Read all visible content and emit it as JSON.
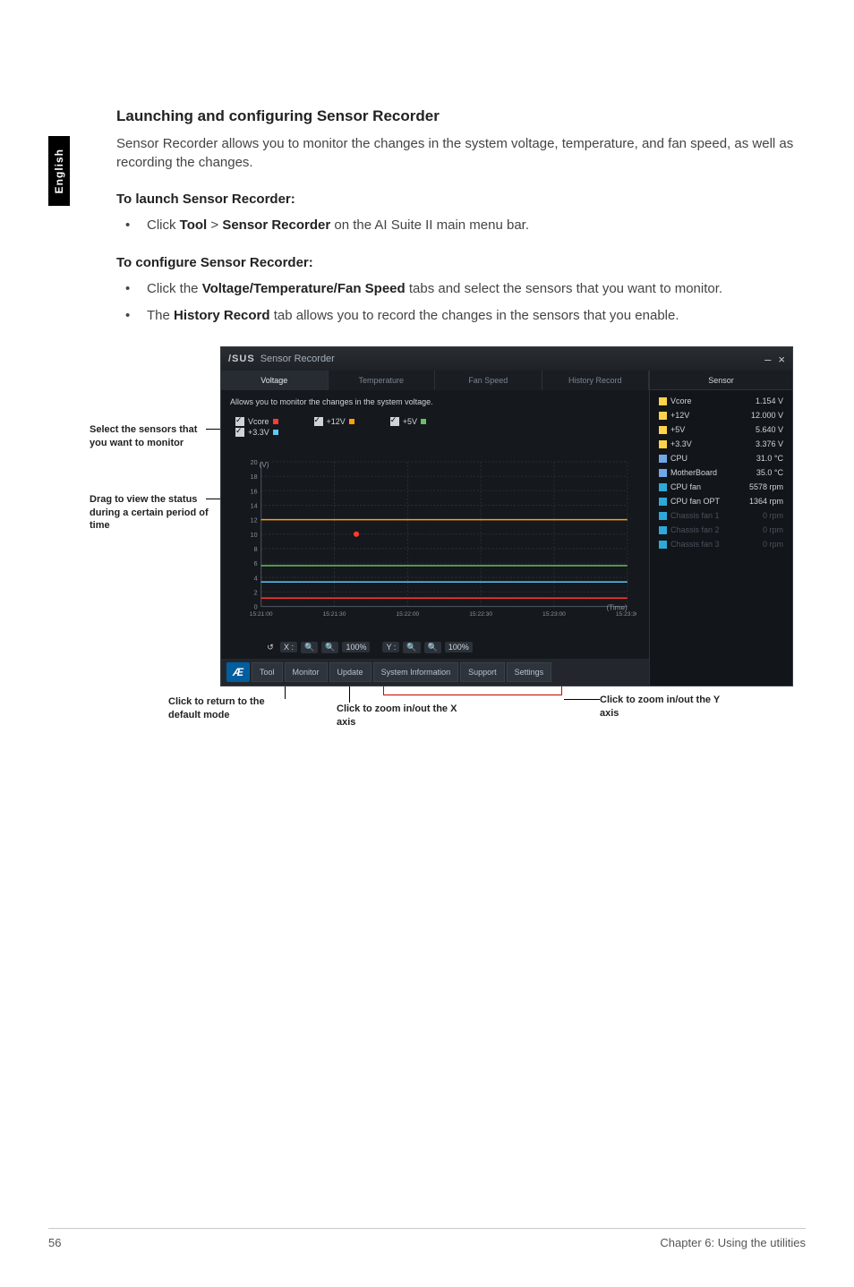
{
  "sidebar_tab": "English",
  "heading": "Launching and configuring Sensor Recorder",
  "lead": "Sensor Recorder allows you to monitor the changes in the system voltage, temperature, and fan speed, as well as recording the changes.",
  "launch_head": "To launch Sensor Recorder:",
  "launch_item_pre": "Click ",
  "launch_tool": "Tool",
  "launch_gt": " > ",
  "launch_sr": "Sensor Recorder",
  "launch_item_post": " on the AI Suite II main menu bar.",
  "config_head": "To configure Sensor Recorder:",
  "config_item1_pre": "Click the ",
  "config_item1_b": "Voltage/Temperature/Fan Speed",
  "config_item1_post": " tabs and select the sensors that you want to monitor.",
  "config_item2_pre": "The ",
  "config_item2_b": "History Record",
  "config_item2_post": " tab allows you to record the changes in the sensors that you enable.",
  "callout_select": "Select the sensors that you want to monitor",
  "callout_drag": "Drag to view the status during a certain period of time",
  "callout_return": "Click to return to the default mode",
  "callout_zoomx": "Click to zoom in/out the X axis",
  "callout_zoomy": "Click to zoom in/out the Y axis",
  "app": {
    "logo": "/SUS",
    "title": "Sensor Recorder",
    "tabs": {
      "voltage": "Voltage",
      "temperature": "Temperature",
      "fanspeed": "Fan Speed",
      "history": "History Record"
    },
    "desc": "Allows you to monitor the changes in the system voltage.",
    "checks": {
      "vcore": "Vcore",
      "p12v": "+12V",
      "p5v": "+5V",
      "p3v": "+3.3V"
    },
    "x_zoom": "X :",
    "y_zoom": "Y :",
    "zoom_pct": "100%",
    "bottombar": {
      "tool": "Tool",
      "monitor": "Monitor",
      "update": "Update",
      "sysinfo": "System Information",
      "support": "Support",
      "settings": "Settings"
    },
    "side_head": "Sensor",
    "sensors": [
      {
        "name": "Vcore",
        "val": "1.154 V",
        "color": "#ffd24a"
      },
      {
        "name": "+12V",
        "val": "12.000 V",
        "color": "#ffd24a"
      },
      {
        "name": "+5V",
        "val": "5.640 V",
        "color": "#ffd24a"
      },
      {
        "name": "+3.3V",
        "val": "3.376 V",
        "color": "#ffd24a"
      },
      {
        "name": "CPU",
        "val": "31.0 °C",
        "color": "#6fa8e6"
      },
      {
        "name": "MotherBoard",
        "val": "35.0 °C",
        "color": "#6fa8e6"
      },
      {
        "name": "CPU fan",
        "val": "5578 rpm",
        "color": "#2ea8d8"
      },
      {
        "name": "CPU fan OPT",
        "val": "1364 rpm",
        "color": "#2ea8d8"
      },
      {
        "name": "Chassis fan 1",
        "val": "0 rpm",
        "dim": true,
        "color": "#2ea8d8"
      },
      {
        "name": "Chassis fan 2",
        "val": "0 rpm",
        "dim": true,
        "color": "#2ea8d8"
      },
      {
        "name": "Chassis fan 3",
        "val": "0 rpm",
        "dim": true,
        "color": "#2ea8d8"
      }
    ]
  },
  "chart_data": {
    "type": "line",
    "title": "",
    "xlabel": "(Time)",
    "ylabel": "(V)",
    "ylim": [
      0,
      20
    ],
    "x_ticks": [
      "15:21:00",
      "15:21:30",
      "15:22:00",
      "15:22:30",
      "15:23:00",
      "15:23:30"
    ],
    "y_ticks": [
      0,
      2,
      4,
      6,
      8,
      10,
      12,
      14,
      16,
      18,
      20
    ],
    "series": [
      {
        "name": "Vcore",
        "color": "#ff3b30",
        "values": [
          1.15,
          1.15,
          1.15,
          1.15,
          1.15,
          1.15
        ]
      },
      {
        "name": "+12V",
        "color": "#ff9f0a",
        "values": [
          12.0,
          12.0,
          12.0,
          12.0,
          12.0,
          12.0
        ]
      },
      {
        "name": "+5V",
        "color": "#67c163",
        "values": [
          5.64,
          5.64,
          5.64,
          5.64,
          5.64,
          5.64
        ]
      },
      {
        "name": "+3.3V",
        "color": "#5ac8fa",
        "values": [
          3.38,
          3.38,
          3.38,
          3.38,
          3.38,
          3.38
        ]
      }
    ]
  },
  "footer": {
    "page": "56",
    "chapter": "Chapter 6: Using the utilities"
  }
}
